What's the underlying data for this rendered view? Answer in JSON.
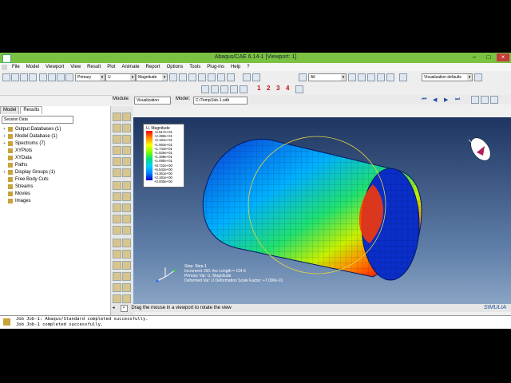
{
  "window": {
    "title": "Abaqus/CAE 6.14-1 [Viewport: 1]"
  },
  "menu": [
    "File",
    "Model",
    "Viewport",
    "View",
    "Result",
    "Plot",
    "Animate",
    "Report",
    "Options",
    "Tools",
    "Plug-ins",
    "Help",
    "?"
  ],
  "toolbar": {
    "step_combo": "Primary",
    "var_combo": "U",
    "invariant_combo": "Magnitude",
    "filter_combo": "All",
    "visualization_defaults": "Visualization defaults",
    "numbers": [
      "1",
      "2",
      "3",
      "4"
    ]
  },
  "context": {
    "module_label": "Module:",
    "module_value": "Visualization",
    "model_label": "Model:",
    "model_value": "C:/Temp/Job-1.odb"
  },
  "tabs": [
    "Model",
    "Results"
  ],
  "session_combo": "Session Data",
  "tree": [
    {
      "label": "Output Databases (1)",
      "expand": "+"
    },
    {
      "label": "Model Database (1)",
      "expand": "+"
    },
    {
      "label": "Spectrums (7)",
      "expand": "+"
    },
    {
      "label": "XYPlots",
      "expand": ""
    },
    {
      "label": "XYData",
      "expand": ""
    },
    {
      "label": "Paths",
      "expand": ""
    },
    {
      "label": "Display Groups (1)",
      "expand": "+"
    },
    {
      "label": "Free Body Cuts",
      "expand": ""
    },
    {
      "label": "Streams",
      "expand": ""
    },
    {
      "label": "Movies",
      "expand": ""
    },
    {
      "label": "Images",
      "expand": ""
    }
  ],
  "legend": {
    "title": "U, Magnitude",
    "values": [
      "+2.617e+01",
      "+2.399e+01",
      "+2.181e+01",
      "+1.963e+01",
      "+1.744e+01",
      "+1.526e+01",
      "+1.308e+01",
      "+1.090e+01",
      "+8.722e+00",
      "+6.542e+00",
      "+4.361e+00",
      "+2.181e+00",
      "+0.000e+00"
    ]
  },
  "viewport_info": [
    "Step: Step-1",
    "Increment  150: Arc Length =    134.6",
    "Primary Var: U, Magnitude",
    "Deformed Var: U   Deformation Scale Factor: +7.000e-01"
  ],
  "prompt": "Drag the mouse in a viewport to rotate the view",
  "brand": "SIMULIA",
  "messages": [
    "Job Job-1: Abaqus/Standard completed successfully.",
    "Job Job-1 completed successfully."
  ]
}
